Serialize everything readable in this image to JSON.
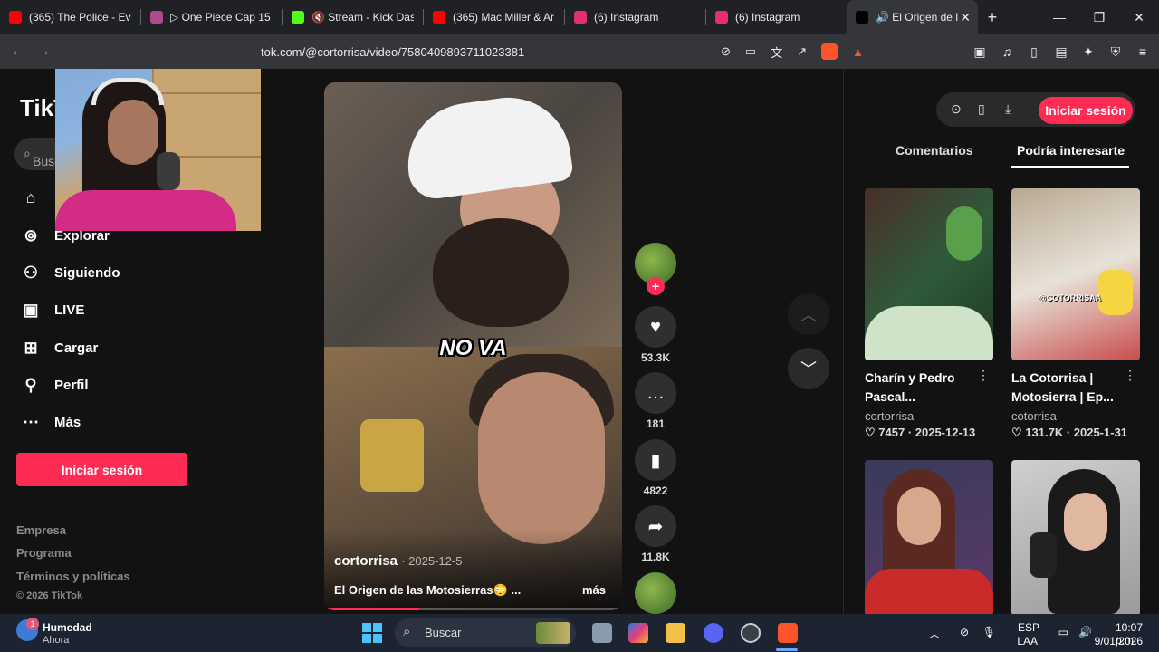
{
  "browser": {
    "tabs": [
      {
        "title": "(365) The Police - Eve",
        "favicon": "youtube",
        "color": "#ff0000"
      },
      {
        "title": "▷ One Piece Cap 15 |",
        "favicon": "anime",
        "color": "#b04a8f"
      },
      {
        "title": "🔇 Stream - Kick Das",
        "favicon": "kick",
        "color": "#53fc18"
      },
      {
        "title": "(365) Mac Miller & Ar",
        "favicon": "youtube",
        "color": "#ff0000"
      },
      {
        "title": "(6) Instagram",
        "favicon": "instagram",
        "color": "#e1306c"
      },
      {
        "title": "(6) Instagram",
        "favicon": "instagram",
        "color": "#e1306c"
      },
      {
        "title": "🔊 El Origen de l",
        "favicon": "tiktok",
        "color": "#000000",
        "active": true
      }
    ],
    "url": "tiktok.com/@cortorrisa/video/7580409893711023381",
    "url_visible": "tok.com/@cortorrisa/video/7580409893711023381"
  },
  "tiktok": {
    "logo": "TikTok",
    "search_placeholder": "Buscar",
    "nav": [
      {
        "label": "Explorar",
        "icon": "compass-icon"
      },
      {
        "label": "Siguiendo",
        "icon": "following-icon"
      },
      {
        "label": "LIVE",
        "icon": "live-icon"
      },
      {
        "label": "Cargar",
        "icon": "upload-icon"
      },
      {
        "label": "Perfil",
        "icon": "profile-icon"
      },
      {
        "label": "Más",
        "icon": "more-icon"
      }
    ],
    "login_button": "Iniciar sesión",
    "footer": [
      "Empresa",
      "Programa",
      "Términos y políticas",
      "© 2026 TikTok"
    ],
    "video": {
      "overlay_text": "NO VA",
      "author": "cortorrisa",
      "date": "2025-12-5",
      "description": "El Origen de las Motosierras😳 ...",
      "more": "más",
      "progress": 0.32
    },
    "actions": {
      "likes": "53.3K",
      "comments": "181",
      "saves": "4822",
      "shares": "11.8K"
    },
    "right_panel": {
      "login_button": "Iniciar sesión",
      "tabs": [
        "Comentarios",
        "Podría interesarte"
      ],
      "active_tab": 1,
      "cards": [
        {
          "title": "Charín y Pedro Pascal...",
          "author": "cortorrisa",
          "views": "7457",
          "date": "2025-12-13"
        },
        {
          "title": "La Cotorrisa | Motosierra | Ep...",
          "author": "cotorrisa",
          "views": "131.7K",
          "date": "2025-1-31"
        },
        {
          "title": "",
          "author": "",
          "views": "",
          "date": ""
        },
        {
          "title": "",
          "author": "",
          "views": "",
          "date": ""
        }
      ],
      "thumb_label": "@COTORRISAA"
    }
  },
  "taskbar": {
    "weather_title": "Humedad",
    "weather_sub": "Ahora",
    "weather_badge": "1",
    "search_label": "Buscar",
    "lang": "ESP",
    "lang2": "LAA",
    "time": "10:07 p.m.",
    "date": "9/01/2026"
  },
  "colors": {
    "accent": "#fe2c55",
    "background": "#121212"
  }
}
